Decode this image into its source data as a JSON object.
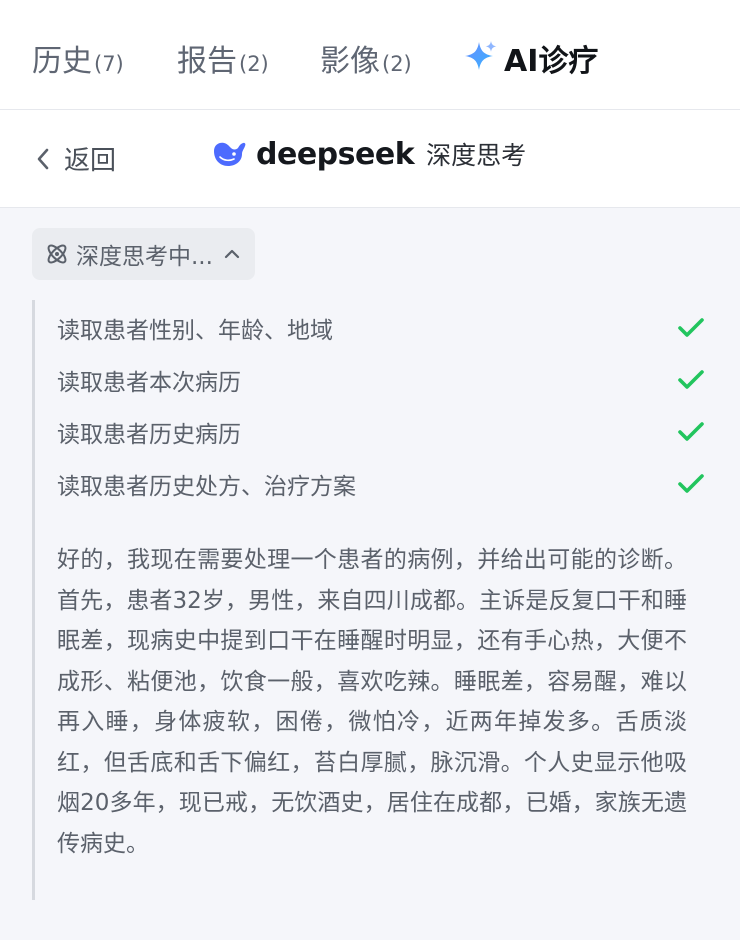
{
  "tabs": [
    {
      "label": "历史",
      "count": "(7)"
    },
    {
      "label": "报告",
      "count": "(2)"
    },
    {
      "label": "影像",
      "count": "(2)"
    },
    {
      "label": "AI诊疗",
      "icon": "sparkle-icon"
    }
  ],
  "subheader": {
    "back_label": "返回",
    "brand_name": "deepseek",
    "brand_mode": "深度思考"
  },
  "thinking": {
    "status": "深度思考中...",
    "steps": [
      {
        "text": "读取患者性别、年龄、地域",
        "status": "done"
      },
      {
        "text": "读取患者本次病历",
        "status": "done"
      },
      {
        "text": "读取患者历史病历",
        "status": "done"
      },
      {
        "text": "读取患者历史处方、治疗方案",
        "status": "done"
      }
    ],
    "paragraph": "好的，我现在需要处理一个患者的病例，并给出可能的诊断。首先，患者32岁，男性，来自四川成都。主诉是反复口干和睡眠差，现病史中提到口干在睡醒时明显，还有手心热，大便不成形、粘便池，饮食一般，喜欢吃辣。睡眠差，容易醒，难以再入睡，身体疲软，困倦，微怕冷，近两年掉发多。舌质淡红，但舌底和舌下偏红，苔白厚腻，脉沉滑。个人史显示他吸烟20多年，现已戒，无饮酒史，居住在成都，已婚，家族无遗传病史。"
  },
  "colors": {
    "accent_blue": "#4d6bfe",
    "check_green": "#22c55e",
    "sparkle_start": "#6a8cff",
    "sparkle_end": "#36b3ff"
  }
}
